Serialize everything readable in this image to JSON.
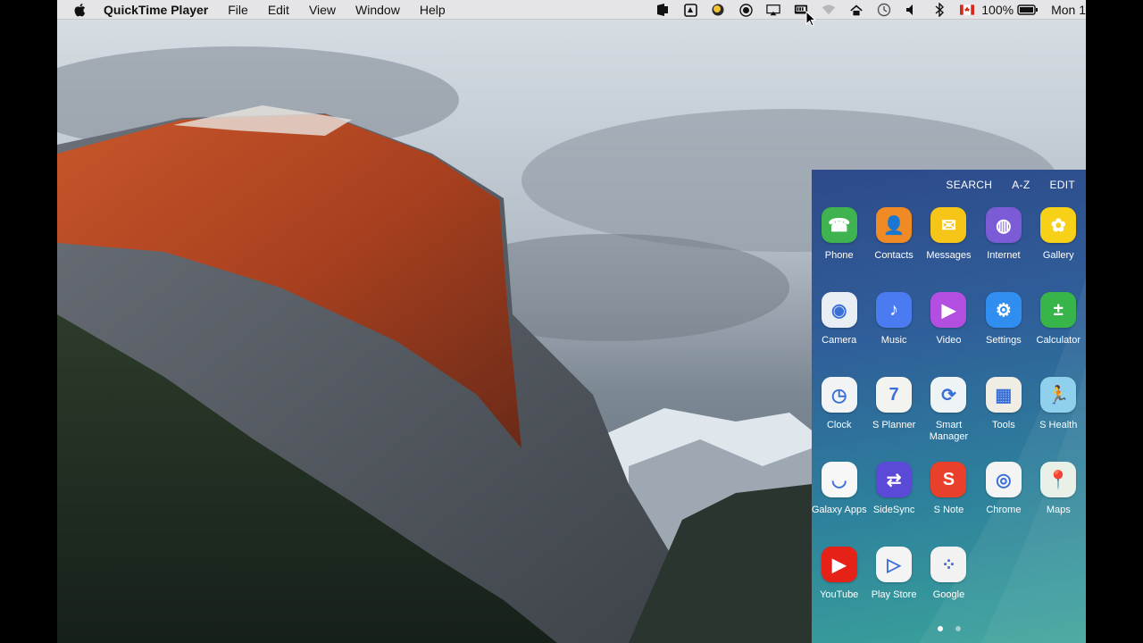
{
  "menubar": {
    "app_name": "QuickTime Player",
    "items": [
      "File",
      "Edit",
      "View",
      "Window",
      "Help"
    ],
    "battery_text": "100%",
    "clock_text": "Mon 1"
  },
  "status_icons": [
    "ms-word-icon",
    "notes-icon",
    "color-orb-icon",
    "record-icon",
    "airplay-icon",
    "mirroring-icon",
    "wifi-icon",
    "home-icon",
    "time-machine-icon",
    "volume-icon",
    "bluetooth-icon",
    "canada-flag-icon",
    "battery-icon"
  ],
  "drawer": {
    "top_actions": [
      "SEARCH",
      "A-Z",
      "EDIT"
    ],
    "apps": [
      {
        "label": "Phone",
        "icon": "phone-icon",
        "color": "#3fb34f",
        "glyph": "☎"
      },
      {
        "label": "Contacts",
        "icon": "contacts-icon",
        "color": "#f08a24",
        "glyph": "👤"
      },
      {
        "label": "Messages",
        "icon": "messages-icon",
        "color": "#f5c518",
        "glyph": "✉"
      },
      {
        "label": "Internet",
        "icon": "internet-icon",
        "color": "#7b5bd6",
        "glyph": "◍"
      },
      {
        "label": "Gallery",
        "icon": "gallery-icon",
        "color": "#f7d117",
        "glyph": "✿"
      },
      {
        "label": "Camera",
        "icon": "camera-icon",
        "color": "#e9eef4",
        "glyph": "◉"
      },
      {
        "label": "Music",
        "icon": "music-icon",
        "color": "#4a7bf0",
        "glyph": "♪"
      },
      {
        "label": "Video",
        "icon": "video-icon",
        "color": "#b24ee0",
        "glyph": "▶"
      },
      {
        "label": "Settings",
        "icon": "settings-icon",
        "color": "#2f8ef0",
        "glyph": "⚙"
      },
      {
        "label": "Calculator",
        "icon": "calculator-icon",
        "color": "#37b54a",
        "glyph": "±"
      },
      {
        "label": "Clock",
        "icon": "clock-icon",
        "color": "#f1f3f5",
        "glyph": "◷"
      },
      {
        "label": "S Planner",
        "icon": "s-planner-icon",
        "color": "#f3f3f0",
        "glyph": "7"
      },
      {
        "label": "Smart Manager",
        "icon": "smart-manager-icon",
        "color": "#eef4f6",
        "glyph": "⟳"
      },
      {
        "label": "Tools",
        "icon": "tools-icon",
        "color": "#f0ede4",
        "glyph": "▦"
      },
      {
        "label": "S Health",
        "icon": "s-health-icon",
        "color": "#8fd0ec",
        "glyph": "🏃"
      },
      {
        "label": "Galaxy Apps",
        "icon": "galaxy-apps-icon",
        "color": "#f7f7f7",
        "glyph": "◡"
      },
      {
        "label": "SideSync",
        "icon": "sidesync-icon",
        "color": "#5b4ad8",
        "glyph": "⇄"
      },
      {
        "label": "S Note",
        "icon": "s-note-icon",
        "color": "#e8402a",
        "glyph": "S"
      },
      {
        "label": "Chrome",
        "icon": "chrome-icon",
        "color": "#f4f4f4",
        "glyph": "◎"
      },
      {
        "label": "Maps",
        "icon": "maps-icon",
        "color": "#e8f0e8",
        "glyph": "📍"
      },
      {
        "label": "YouTube",
        "icon": "youtube-icon",
        "color": "#e62117",
        "glyph": "▶"
      },
      {
        "label": "Play Store",
        "icon": "play-store-icon",
        "color": "#f4f4f4",
        "glyph": "▷"
      },
      {
        "label": "Google",
        "icon": "google-folder-icon",
        "color": "#f2f2f2",
        "glyph": "⁘"
      }
    ],
    "page_count": 2,
    "active_page": 1
  }
}
